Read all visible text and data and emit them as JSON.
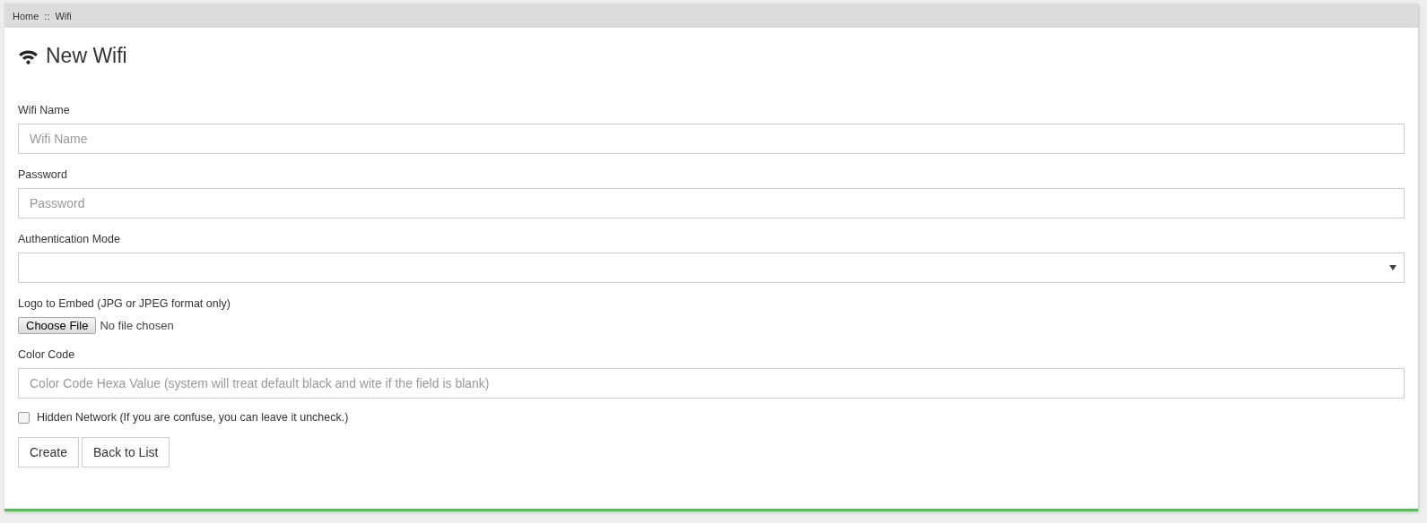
{
  "breadcrumb": [
    "Home",
    "::",
    "Wifi"
  ],
  "title": "New Wifi",
  "fields": [
    {
      "kind": "text",
      "label": "Wifi Name",
      "placeholder": "Wifi Name"
    },
    {
      "kind": "text",
      "label": "Password",
      "placeholder": "Password"
    },
    {
      "kind": "select",
      "label": "Authentication Mode"
    },
    {
      "kind": "file",
      "label": "Logo to Embed (JPG or JPEG format only)",
      "button": "Choose File",
      "status": "No file chosen"
    },
    {
      "kind": "text",
      "label": "Color Code",
      "placeholder": "Color Code Hexa Value (system will treat default black and wite if the field is blank)"
    }
  ],
  "hidden_network": {
    "label": "Hidden Network (If you are confuse, you can leave it uncheck.)",
    "checked": false
  },
  "buttons": [
    "Create",
    "Back to List"
  ]
}
